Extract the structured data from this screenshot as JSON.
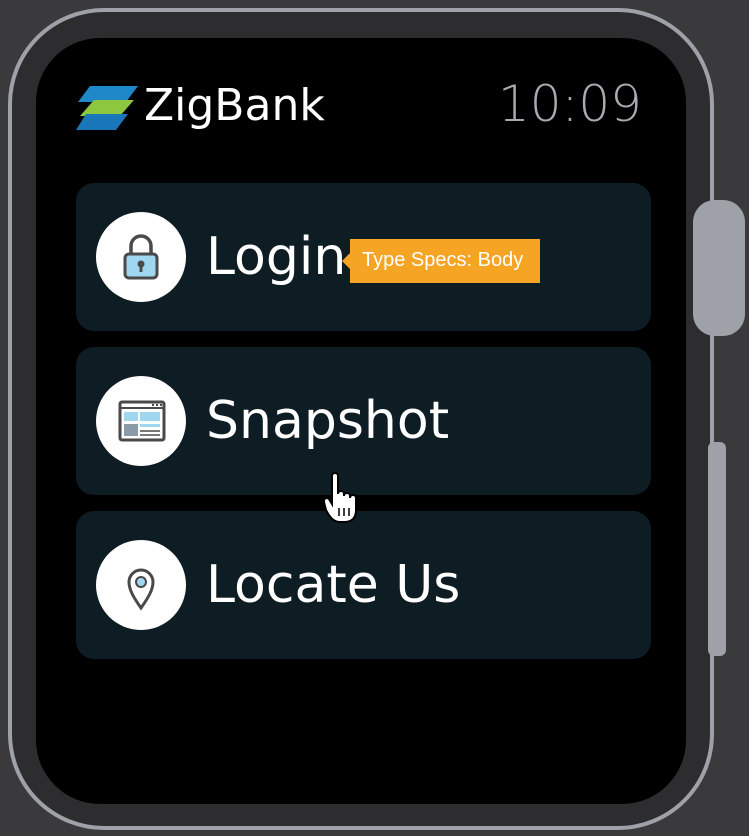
{
  "header": {
    "app_name": "ZigBank",
    "time": "10:09"
  },
  "menu": [
    {
      "label": "Login",
      "icon": "lock-icon"
    },
    {
      "label": "Snapshot",
      "icon": "dashboard-icon"
    },
    {
      "label": "Locate Us",
      "icon": "location-pin-icon"
    }
  ],
  "tooltip": {
    "text": "Type Specs: Body"
  },
  "colors": {
    "screen": "#000000",
    "card": "#0e1c24",
    "tooltip": "#f5a424",
    "frame": "#9ea1a8",
    "clock": "#a8abb2"
  }
}
